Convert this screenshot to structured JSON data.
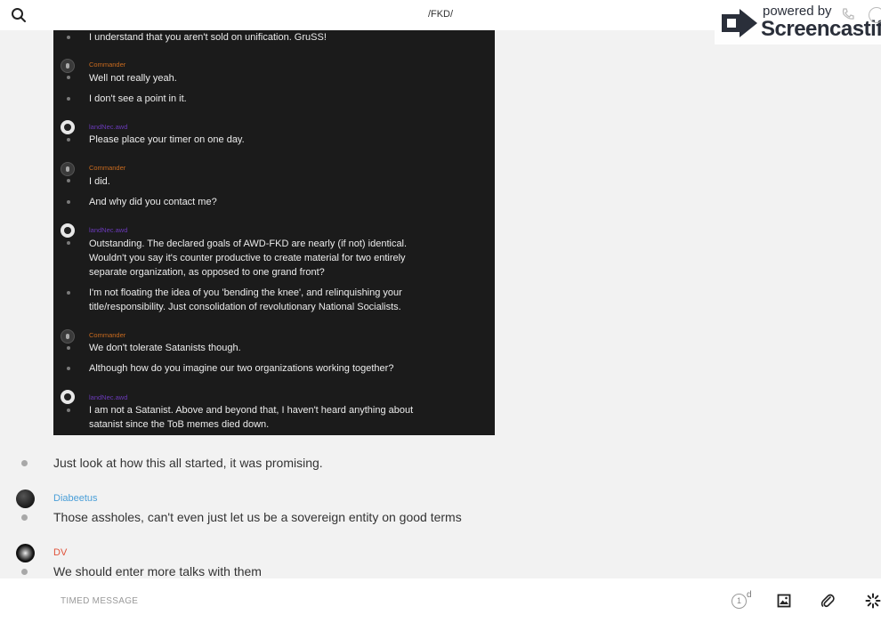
{
  "header": {
    "channel": "/FKD/"
  },
  "watermark": {
    "small": "powered by",
    "big": "Screencastify"
  },
  "screenshot": {
    "lines": [
      "I understand that you aren't sold on unification. GruSS!",
      "Well not really yeah.",
      "I don't see a point in it.",
      "Please place your timer on one day.",
      "I did.",
      "And why did you contact me?",
      "Outstanding. The declared goals of AWD-FKD are nearly (if not) identical.",
      "Wouldn't you say it's counter productive to create material for two entirely",
      "separate organization, as opposed to one grand front?",
      "I'm not floating the idea of you 'bending the knee', and relinquishing your",
      "title/responsibility. Just consolidation of revolutionary National Socialists.",
      "We don't tolerate Satanists though.",
      "Although how do you imagine our two organizations working together?",
      "I am not a Satanist. Above and beyond that, I haven't heard anything about",
      "satanist since the ToB memes died down."
    ],
    "names": {
      "commander": "Commander",
      "other": "landNec.awd"
    },
    "colors": {
      "commander": "#c86a1e",
      "other": "#6a3ab8"
    }
  },
  "messages": [
    {
      "text": "Just look at how this all started, it was promising."
    },
    {
      "author": "Diabeetus",
      "author_color": "#4a9fd8",
      "text": "Those assholes, can't even just let us be a sovereign entity on good terms"
    },
    {
      "author": "DV",
      "author_color": "#e0533b",
      "text": "We should enter more talks with them"
    }
  ],
  "composer": {
    "placeholder": "TIMED MESSAGE",
    "timer_value": "1",
    "timer_unit": "d"
  }
}
